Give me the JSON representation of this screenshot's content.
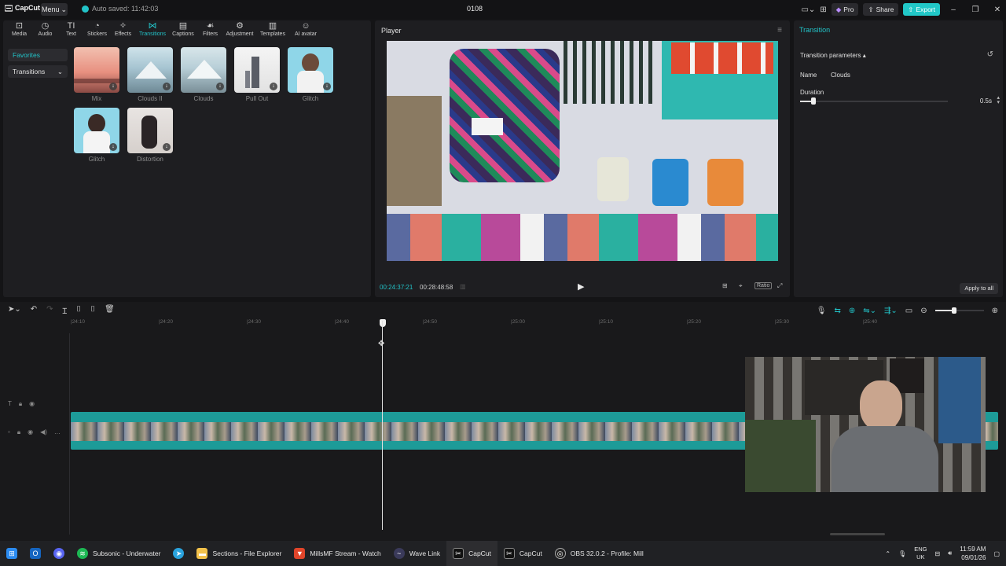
{
  "titlebar": {
    "logo": "CapCut",
    "menu_label": "Menu",
    "autosave_text": "Auto saved: 11:42:03",
    "project_name": "0108",
    "pro_label": "Pro",
    "share_label": "Share",
    "export_label": "Export"
  },
  "toolbar": {
    "tabs": [
      {
        "label": "Media",
        "icon": "media-icon"
      },
      {
        "label": "Audio",
        "icon": "audio-icon"
      },
      {
        "label": "Text",
        "icon": "text-icon"
      },
      {
        "label": "Stickers",
        "icon": "stickers-icon"
      },
      {
        "label": "Effects",
        "icon": "effects-icon"
      },
      {
        "label": "Transitions",
        "icon": "transitions-icon",
        "active": true
      },
      {
        "label": "Captions",
        "icon": "captions-icon"
      },
      {
        "label": "Filters",
        "icon": "filters-icon"
      },
      {
        "label": "Adjustment",
        "icon": "adjustment-icon"
      },
      {
        "label": "Templates",
        "icon": "templates-icon"
      },
      {
        "label": "AI avatar",
        "icon": "ai-avatar-icon"
      }
    ]
  },
  "sidebar": {
    "favorites": "Favorites",
    "transitions": "Transitions"
  },
  "transitions_grid": [
    {
      "label": "Mix"
    },
    {
      "label": "Clouds II"
    },
    {
      "label": "Clouds"
    },
    {
      "label": "Pull Out"
    },
    {
      "label": "Glitch"
    },
    {
      "label": "Glitch"
    },
    {
      "label": "Distortion"
    }
  ],
  "player": {
    "title": "Player",
    "current_time": "00:24:37:21",
    "total_time": "00:28:48:58",
    "ratio_label": "Ratio"
  },
  "details": {
    "title": "Transition",
    "params_header": "Transition parameters",
    "name_label": "Name",
    "name_value": "Clouds",
    "duration_label": "Duration",
    "duration_value": "0.5s",
    "duration_fraction": 0.09,
    "apply_all": "Apply to all"
  },
  "timeline": {
    "ruler_ticks": [
      "24:10",
      "24:20",
      "24:30",
      "24:40",
      "24:50",
      "25:00",
      "25:10",
      "25:20",
      "25:30",
      "25:40"
    ]
  },
  "taskbar": {
    "items": [
      {
        "label": "",
        "icon": "windows-start-icon"
      },
      {
        "label": "",
        "icon": "outlook-icon"
      },
      {
        "label": "",
        "icon": "discord-icon"
      },
      {
        "label": "Subsonic - Underwater",
        "icon": "spotify-icon"
      },
      {
        "label": "",
        "icon": "telegram-icon"
      },
      {
        "label": "Sections - File Explorer",
        "icon": "folder-icon"
      },
      {
        "label": "MillsMF Stream - Watch",
        "icon": "brave-icon"
      },
      {
        "label": "Wave Link",
        "icon": "wave-link-icon"
      },
      {
        "label": "CapCut",
        "icon": "capcut-icon",
        "active": true
      },
      {
        "label": "CapCut",
        "icon": "capcut-icon"
      },
      {
        "label": "OBS 32.0.2 - Profile: Mill",
        "icon": "obs-icon"
      }
    ],
    "lang_top": "ENG",
    "lang_bottom": "UK",
    "time": "11:59 AM",
    "date": "09/01/26"
  },
  "colors": {
    "accent": "#22c3c8",
    "panel": "#1e1e21",
    "background": "#141416",
    "clip": "#1d9b98"
  }
}
